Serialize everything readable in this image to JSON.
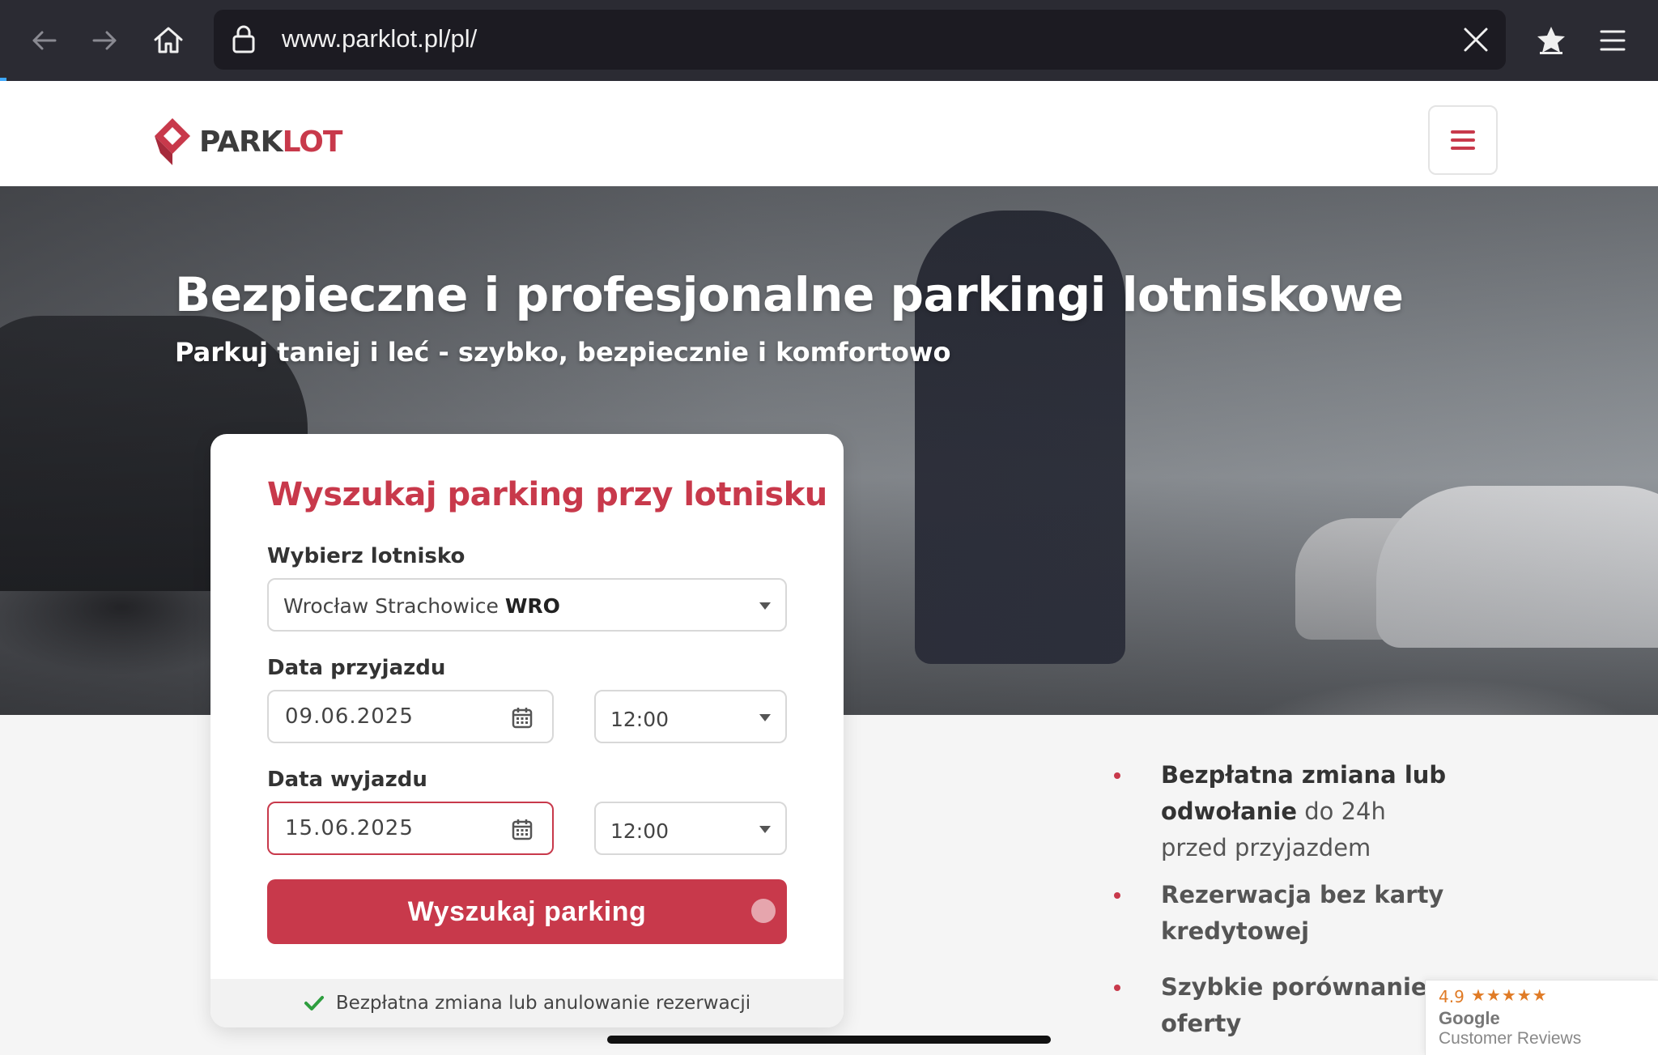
{
  "browser": {
    "url": "www.parklot.pl/pl/",
    "icons": [
      "back-arrow-icon",
      "forward-arrow-icon",
      "home-icon",
      "lock-icon",
      "close-icon",
      "bookmark-star-icon",
      "menu-icon"
    ]
  },
  "header": {
    "logo_dark": "PARK",
    "logo_accent": "LOT",
    "brand_color": "#c8394b"
  },
  "hero": {
    "title": "Bezpieczne i profesjonalne parkingi lotniskowe",
    "subtitle": "Parkuj taniej i leć - szybko, bezpiecznie i komfortowo"
  },
  "search": {
    "title": "Wyszukaj parking przy lotnisku",
    "airport_label": "Wybierz lotnisko",
    "airport_city": "Wrocław Strachowice",
    "airport_code": "WRO",
    "arrival_label": "Data przyjazdu",
    "arrival_date": "09.06.2025",
    "arrival_time": "12:00",
    "departure_label": "Data wyjazdu",
    "departure_date": "15.06.2025",
    "departure_time": "12:00",
    "button_label": "Wyszukaj parking",
    "footer_note": "Bezpłatna zmiana lub anulowanie rezerwacji"
  },
  "benefits": {
    "b1_strong": "Bezpłatna zmiana lub odwołanie",
    "b1_rest": " do 24h przed przyjazdem",
    "b2": "Rezerwacja bez karty kredytowej",
    "b3": "Szybkie porównanie oferty"
  },
  "reviews": {
    "rating": "4.9",
    "stars": "★★★★★",
    "provider": "Google",
    "caption": "Customer Reviews"
  }
}
